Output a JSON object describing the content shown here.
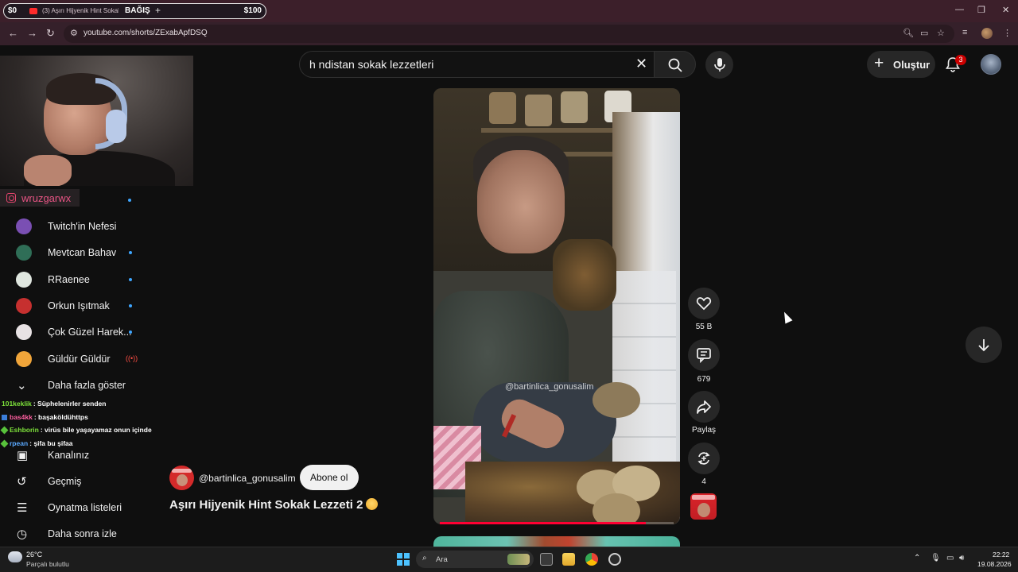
{
  "browser": {
    "donation_left": "$0",
    "donation_right": "$100",
    "donation_label": "BAĞIŞ",
    "tab_title": "(3) Aşırı Hijyenik Hint Sokak",
    "url": "youtube.com/shorts/ZExabApfDSQ"
  },
  "stream_overlay": {
    "instagram_handle": "wruzgarwx"
  },
  "sidebar": {
    "subscriptions": [
      {
        "label": "Twitch'in Nefesi",
        "live": "none",
        "avatar_color": "#7a4fb3"
      },
      {
        "label": "Mevtcan Bahav",
        "live": "dot",
        "avatar_color": "#2f6e57"
      },
      {
        "label": "RRaenee",
        "live": "dot",
        "avatar_color": "#dfe6df"
      },
      {
        "label": "Orkun Işıtmak",
        "live": "dot",
        "avatar_color": "#c6302f"
      },
      {
        "label": "Çok Güzel Harek...",
        "live": "dot",
        "avatar_color": "#e8e2e4"
      },
      {
        "label": "Güldür Güldür",
        "live": "broadcast",
        "avatar_color": "#f0a53a"
      }
    ],
    "show_more": "Daha fazla göster",
    "you_items": [
      {
        "label": "Kanalınız",
        "icon": "account-box-icon"
      },
      {
        "label": "Geçmiş",
        "icon": "history-icon"
      },
      {
        "label": "Oynatma listeleri",
        "icon": "playlist-icon"
      },
      {
        "label": "Daha sonra izle",
        "icon": "clock-icon"
      }
    ]
  },
  "chat": [
    {
      "user": "101keklik",
      "message": ": Süphelenirler senden",
      "color": "#7ee23b",
      "badge": "none"
    },
    {
      "user": "bas4kk",
      "message": ": başaköldühttps",
      "color": "#ff5fa0",
      "badge": "blue"
    },
    {
      "user": "Eshborin",
      "message": ": virüs bile yaşayamaz onun içinde",
      "color": "#7ee23b",
      "badge": "green"
    },
    {
      "user": "rpean",
      "message": ": şifa bu şifaa",
      "color": "#5aa9ff",
      "badge": "green"
    }
  ],
  "header": {
    "search_query": "h ndistan sokak lezzetleri",
    "create_label": "Oluştur",
    "notification_count": "3"
  },
  "short": {
    "watermark": "@bartinlica_gonusalim",
    "progress": 0.88,
    "channel": "@bartinlica_gonusalim",
    "subscribe_label": "Abone ol",
    "title": "Aşırı Hijyenik Hint Sokak Lezzeti 2",
    "actions": {
      "like_count": "55 B",
      "comment_count": "679",
      "share_label": "Paylaş",
      "remix_count": "4"
    }
  },
  "taskbar": {
    "temperature": "26°C",
    "weather": "Parçalı bulutlu",
    "search_label": "Ara",
    "time": "22:22",
    "date": "19.08.2026"
  }
}
